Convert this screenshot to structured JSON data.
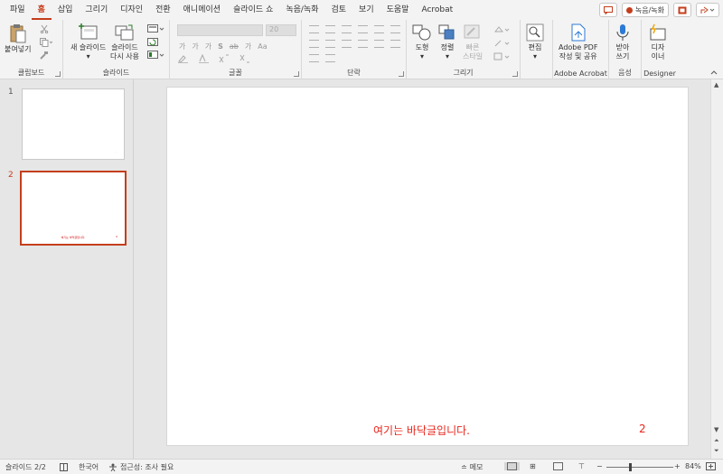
{
  "menu": {
    "tabs": [
      "파일",
      "홈",
      "삽입",
      "그리기",
      "디자인",
      "전환",
      "애니메이션",
      "슬라이드 쇼",
      "녹음/녹화",
      "검토",
      "보기",
      "도움말",
      "Acrobat"
    ],
    "active_tab": "홈",
    "record_label": "녹음/녹화"
  },
  "ribbon": {
    "clipboard": {
      "paste_label": "붙여넣기",
      "group_label": "클립보드"
    },
    "slides": {
      "new_slide_label": "새 슬라이드",
      "reuse_line1": "슬라이드",
      "reuse_line2": "다시 사용",
      "group_label": "슬라이드"
    },
    "font": {
      "size_value": "20",
      "group_label": "글꼴",
      "buttons": [
        "가",
        "가",
        "가",
        "S",
        "ab",
        "가",
        "Aa"
      ]
    },
    "paragraph": {
      "group_label": "단락"
    },
    "drawing": {
      "shape_label": "도형",
      "arrange_label": "정렬",
      "quick_line1": "빠른",
      "quick_line2": "스타일",
      "group_label": "그리기"
    },
    "editing": {
      "label": "편집"
    },
    "adobe": {
      "line1": "Adobe PDF",
      "line2": "작성 및 공유",
      "group_label": "Adobe Acrobat"
    },
    "voice": {
      "line1": "받아",
      "line2": "쓰기",
      "group_label": "음성"
    },
    "designer": {
      "line1": "디자",
      "line2": "이너",
      "group_label": "Designer"
    }
  },
  "thumbnails": [
    {
      "number": "1",
      "footer": "",
      "page": ""
    },
    {
      "number": "2",
      "footer": "여기는 바닥글입니다.",
      "page": "2"
    }
  ],
  "slide": {
    "footer_text": "여기는 바닥글입니다.",
    "page_number": "2"
  },
  "status": {
    "slide_count": "슬라이드 2/2",
    "language": "한국어",
    "accessibility": "접근성: 조사 필요",
    "notes_label": "메모",
    "zoom": "84%"
  },
  "colors": {
    "accent": "#c43e1c",
    "footer_red": "#e8261c"
  }
}
